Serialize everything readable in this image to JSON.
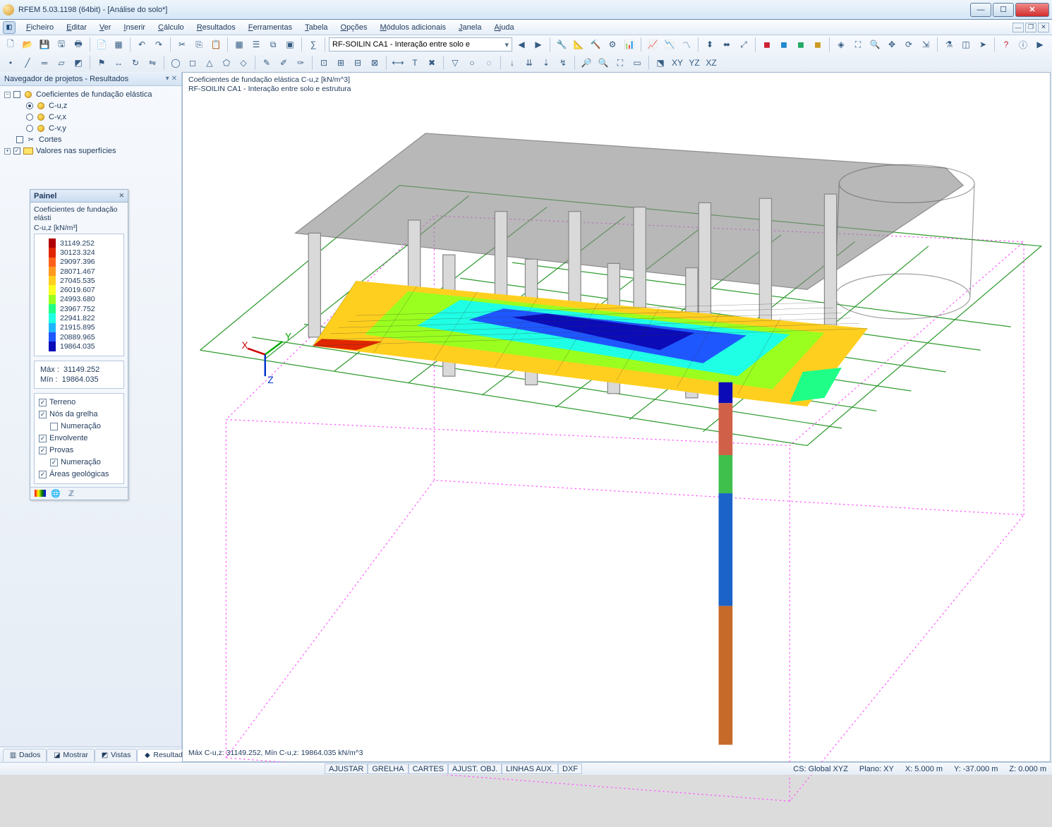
{
  "window": {
    "title": "RFEM 5.03.1198 (64bit) - [Análise do solo*]"
  },
  "menus": [
    "Ficheiro",
    "Editar",
    "Ver",
    "Inserir",
    "Cálculo",
    "Resultados",
    "Ferramentas",
    "Tabela",
    "Opções",
    "Módulos adicionais",
    "Janela",
    "Ajuda"
  ],
  "combo": "RF-SOILIN CA1 - Interação entre solo e ",
  "navigator": {
    "title": "Navegador de projetos - Resultados",
    "root": "Coeficientes de fundação elástica",
    "items": [
      {
        "label": "C-u,z",
        "selected": true
      },
      {
        "label": "C-v,x",
        "selected": false
      },
      {
        "label": "C-v,y",
        "selected": false
      }
    ],
    "cortes": "Cortes",
    "valores": "Valores nas superfícies"
  },
  "painel": {
    "title": "Painel",
    "subtitle1": "Coeficientes de fundação elásti",
    "subtitle2": "C-u,z [kN/m³]",
    "legend": [
      {
        "c": "#b10000",
        "v": "31149.252"
      },
      {
        "c": "#e02600",
        "v": "30123.324"
      },
      {
        "c": "#ff611b",
        "v": "29097.396"
      },
      {
        "c": "#ff9a1f",
        "v": "28071.467"
      },
      {
        "c": "#ffcf1f",
        "v": "27045.535"
      },
      {
        "c": "#f9ff1f",
        "v": "26019.607"
      },
      {
        "c": "#9aff1f",
        "v": "24993.680"
      },
      {
        "c": "#1fff87",
        "v": "23967.752"
      },
      {
        "c": "#1fffe5",
        "v": "22941.822"
      },
      {
        "c": "#1fb6ff",
        "v": "21915.895"
      },
      {
        "c": "#1f57ff",
        "v": "20889.965"
      },
      {
        "c": "#0b0bb8",
        "v": "19864.035"
      }
    ],
    "max_label": "Máx  :",
    "max_val": "31149.252",
    "min_label": "Mín  :",
    "min_val": "19864.035",
    "checks": [
      {
        "label": "Terreno",
        "on": true,
        "indent": false
      },
      {
        "label": "Nós da grelha",
        "on": true,
        "indent": false
      },
      {
        "label": "Numeração",
        "on": false,
        "indent": true
      },
      {
        "label": "Envolvente",
        "on": true,
        "indent": false
      },
      {
        "label": "Provas",
        "on": true,
        "indent": false
      },
      {
        "label": "Numeração",
        "on": true,
        "indent": true
      },
      {
        "label": "Áreas geológicas",
        "on": true,
        "indent": false
      }
    ]
  },
  "viewport": {
    "line1": "Coeficientes de fundação elástica C-u,z [kN/m^3]",
    "line2": "RF-SOILIN CA1 - Interação entre solo e estrutura",
    "bottom": "Máx C-u,z: 31149.252, Mín C-u,z: 19864.035 kN/m^3"
  },
  "nav_tabs": [
    {
      "icon": "▥",
      "label": "Dados"
    },
    {
      "icon": "◪",
      "label": "Mostrar"
    },
    {
      "icon": "◩",
      "label": "Vistas"
    },
    {
      "icon": "◆",
      "label": "Resultados",
      "active": true
    }
  ],
  "status": {
    "toggles": [
      "AJUSTAR",
      "GRELHA",
      "CARTES",
      "AJUST. OBJ.",
      "LINHAS AUX.",
      "DXF"
    ],
    "cs": "CS: Global XYZ",
    "plane": "Plano: XY",
    "x": "X: 5.000 m",
    "y": "Y: -37.000 m",
    "z": "Z: 0.000 m"
  }
}
